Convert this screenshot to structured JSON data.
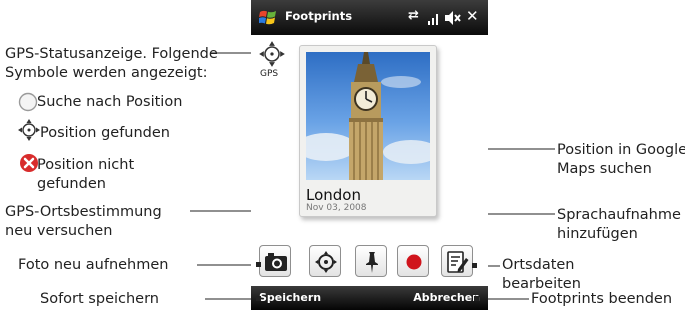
{
  "window": {
    "title": "Footprints",
    "status_icons": [
      "connectivity-icon",
      "signal-icon",
      "speaker-muted-icon",
      "close-icon"
    ]
  },
  "gps": {
    "label": "GPS"
  },
  "photo": {
    "place": "London",
    "date": "Nov 03, 2008"
  },
  "softkeys": {
    "left": "Speichern",
    "right": "Abbrechen"
  },
  "toolbar": {
    "buttons": [
      "camera-icon",
      "gps-refresh-icon",
      "pin-icon",
      "record-icon",
      "edit-icon"
    ]
  },
  "annotations": {
    "gps_status_line1": "GPS-Statusanzeige. Folgende",
    "gps_status_line2": "Symbole werden angezeigt:",
    "searching": "Suche nach Position",
    "found": "Position gefunden",
    "not_found_line1": "Position nicht",
    "not_found_line2": "gefunden",
    "retry_line1": "GPS-Ortsbestimmung",
    "retry_line2": "neu versuchen",
    "retake": "Foto neu aufnehmen",
    "save_now": "Sofort speichern",
    "maps_line1": "Position in Google",
    "maps_line2": "Maps suchen",
    "voice_line1": "Sprachaufnahme",
    "voice_line2": "hinzufügen",
    "edit_line1": "Ortsdaten",
    "edit_line2": "bearbeiten",
    "exit": "Footprints beenden"
  },
  "colors": {
    "titlebar": "#111111",
    "record_red": "#d0141c",
    "error_red": "#d82c2c",
    "sky_blue": "#4d8ad8"
  }
}
